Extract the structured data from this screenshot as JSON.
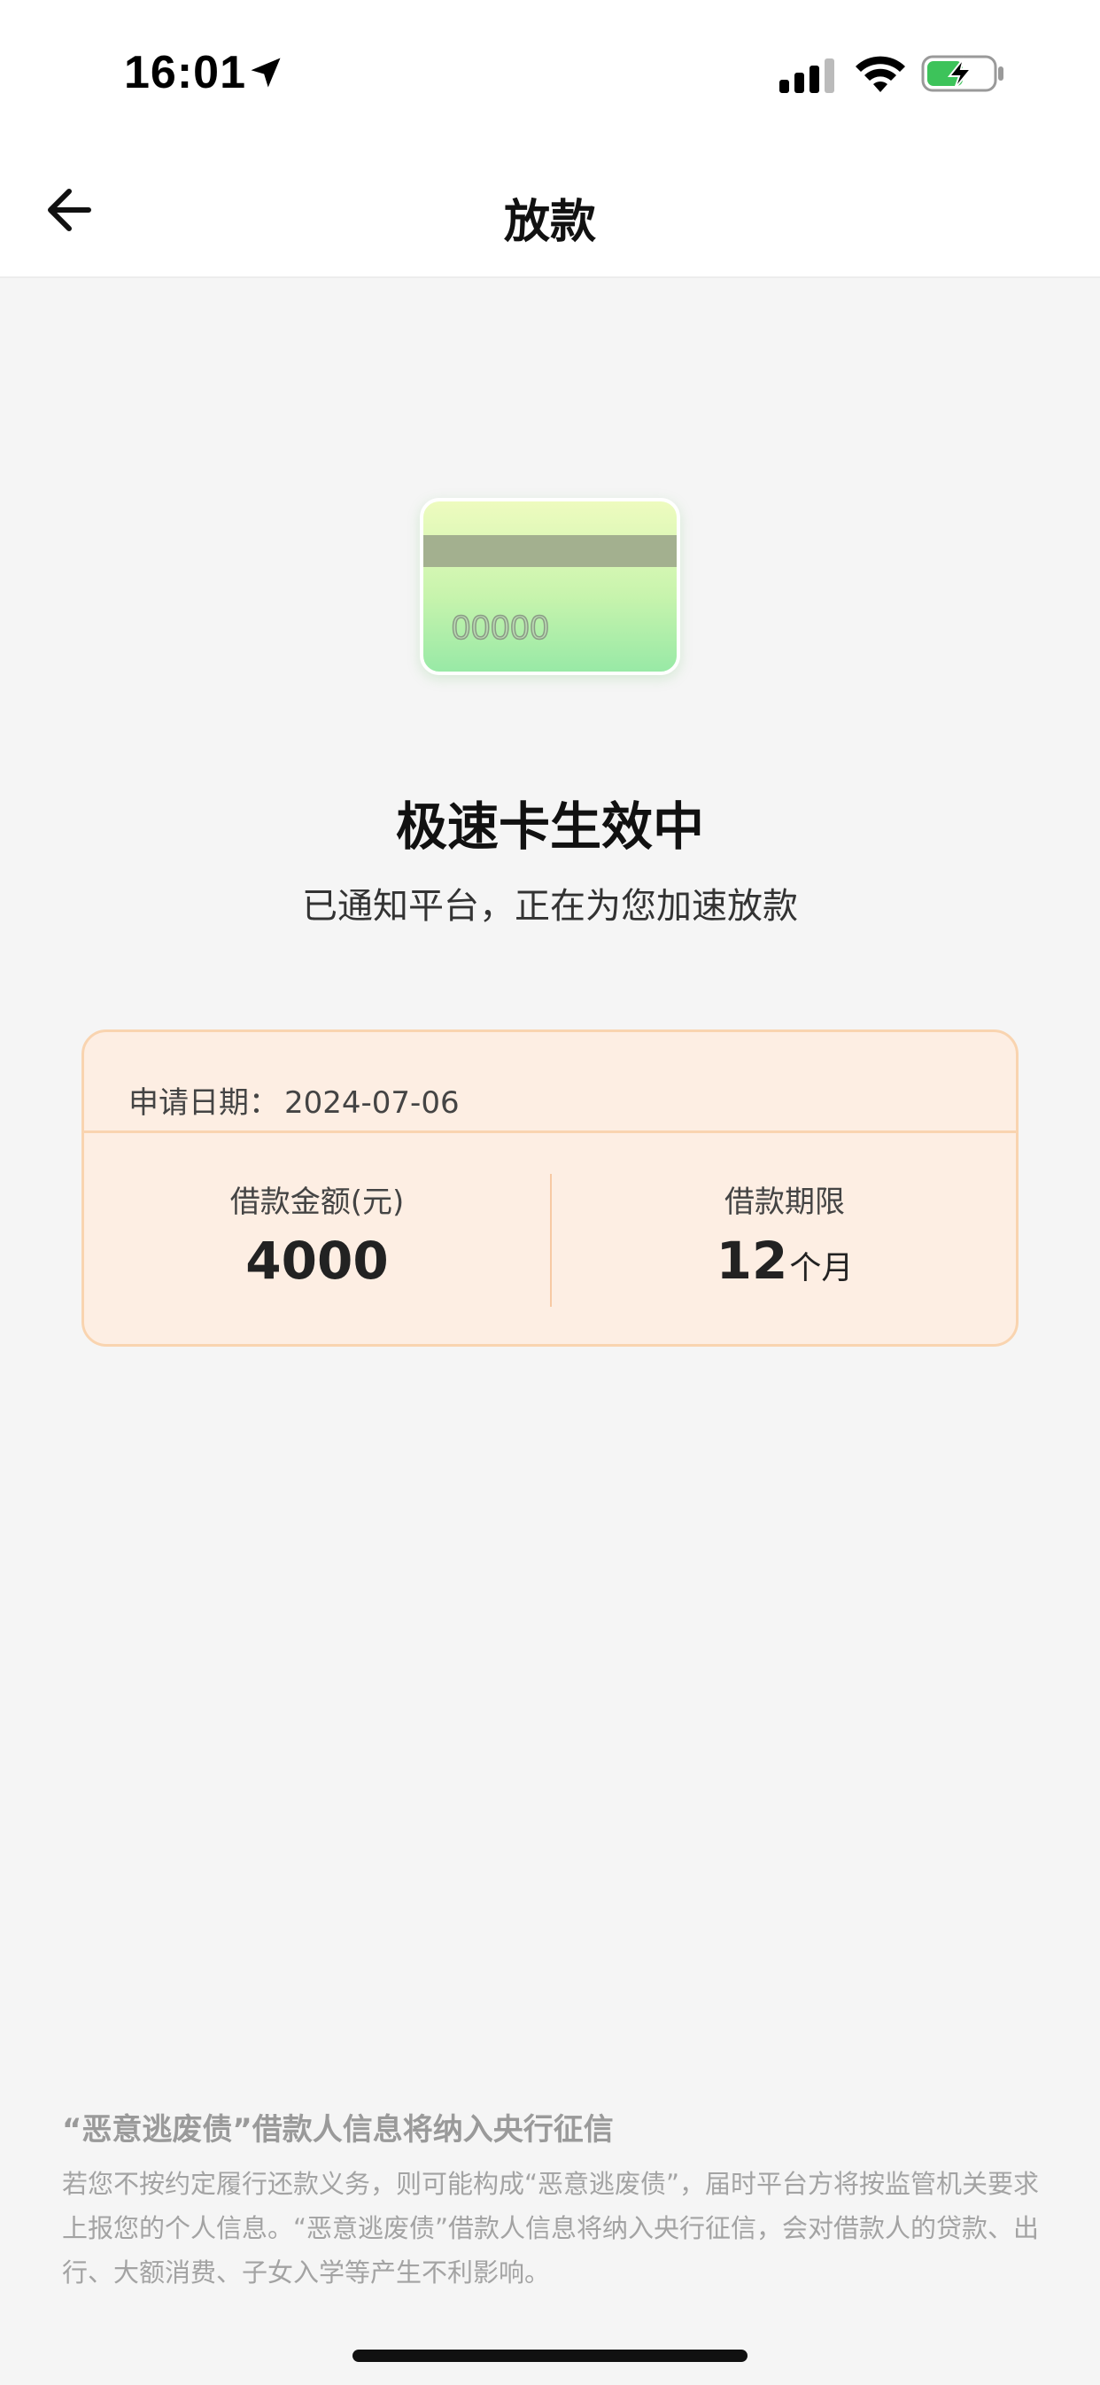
{
  "status_bar": {
    "time": "16:01",
    "icons": [
      "location-arrow-icon",
      "cellular-signal-icon",
      "wifi-icon",
      "battery-charging-icon"
    ],
    "battery_color": "#3dc35a"
  },
  "nav": {
    "title": "放款",
    "back_icon": "arrow-left-icon"
  },
  "status": {
    "title": "极速卡生效中",
    "subtitle": "已通知平台，正在为您加速放款",
    "card_number": "00000"
  },
  "loan": {
    "apply_date_label": "申请日期：",
    "apply_date": "2024-07-06",
    "amount_label": "借款金额(元)",
    "amount": "4000",
    "term_label": "借款期限",
    "term": "12",
    "term_unit": "个月"
  },
  "notice": {
    "title": "“恶意逃废债”借款人信息将纳入央行征信",
    "text": "若您不按约定履行还款义务，则可能构成“恶意逃废债”，届时平台方将按监管机关要求上报您的个人信息。“恶意逃废债”借款人信息将纳入央行征信，会对借款人的贷款、出行、大额消费、子女入学等产生不利影响。"
  },
  "colors": {
    "loan_card_bg": "#fdeee3",
    "loan_card_border": "#f9d4b0",
    "page_bg": "#f5f5f5"
  }
}
